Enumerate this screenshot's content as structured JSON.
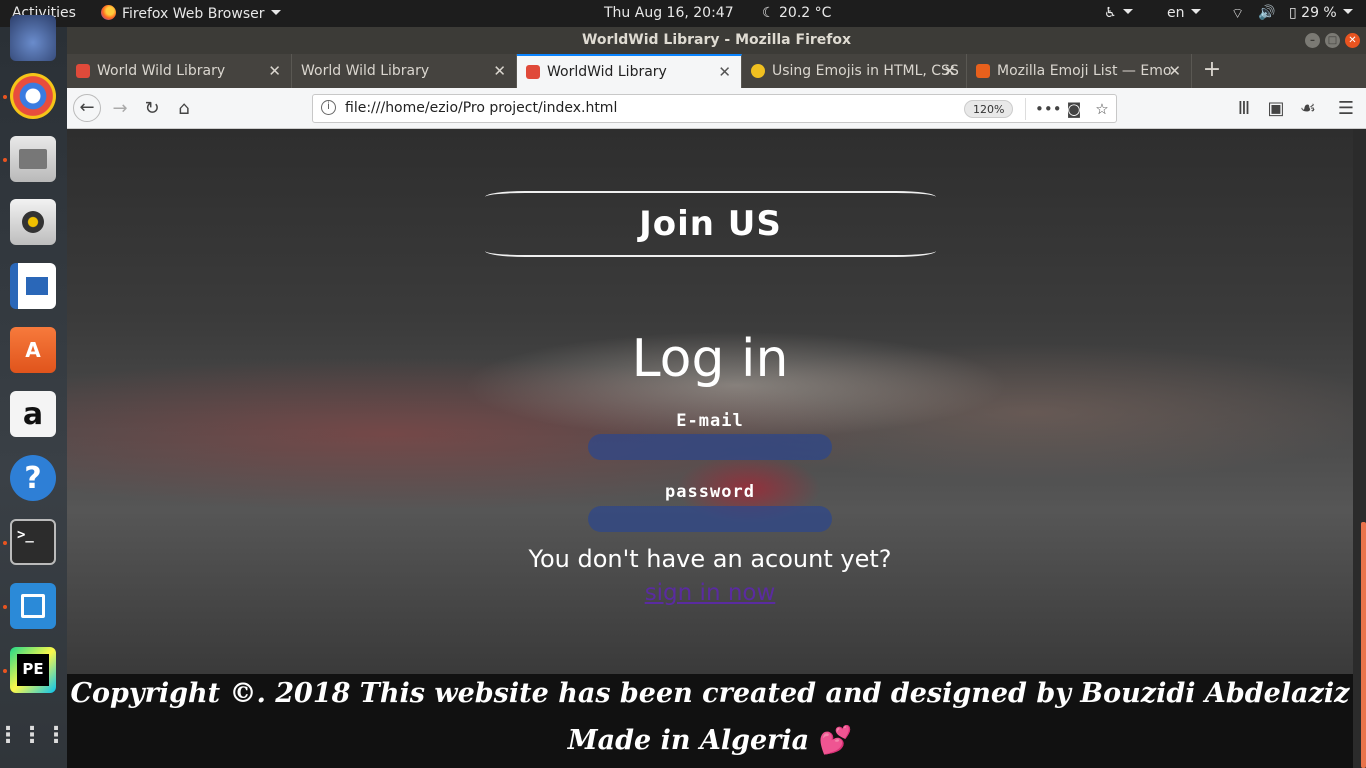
{
  "system_bar": {
    "activities": "Activities",
    "app_menu": "Firefox Web Browser",
    "clock": "Thu Aug 16, 20:47",
    "weather": "20.2 °C",
    "language": "en",
    "battery": "29 %"
  },
  "window": {
    "title": "WorldWid Library - Mozilla Firefox"
  },
  "tabs": [
    {
      "label": "World Wild Library",
      "icon_color": "#e04a3a"
    },
    {
      "label": "World Wild Library",
      "icon_color": ""
    },
    {
      "label": "WorldWid Library",
      "icon_color": "#e04a3a"
    },
    {
      "label": "Using Emojis in HTML, CSS",
      "icon_color": "#f0c020"
    },
    {
      "label": "Mozilla Emoji List — Emo",
      "icon_color": "#e8601c"
    }
  ],
  "navbar": {
    "url": "file:///home/ezio/Pro project/index.html",
    "zoom": "120%"
  },
  "page": {
    "join_button": "Join US",
    "login_title": "Log in",
    "email_label": "E-mail",
    "password_label": "password",
    "no_account_text": "You don't have an acount yet?",
    "signin_link": "sign in now"
  },
  "footer": {
    "line1": "Copyright ©. 2018 This website has been created and designed by Bouzidi Abdelaziz",
    "line2": "Made in Algeria",
    "heart": "💕"
  },
  "dock": {
    "icons": [
      "firefox-icon",
      "chromium-icon",
      "files-icon",
      "rhythmbox-icon",
      "writer-icon",
      "software-center-icon",
      "amazon-icon",
      "help-icon",
      "terminal-icon",
      "brackets-icon",
      "pycharm-icon",
      "show-apps-icon"
    ],
    "amazon_label": "a",
    "help_label": "?",
    "terminal_label": ">_",
    "pycharm_label": "PE",
    "software_label": "A"
  }
}
